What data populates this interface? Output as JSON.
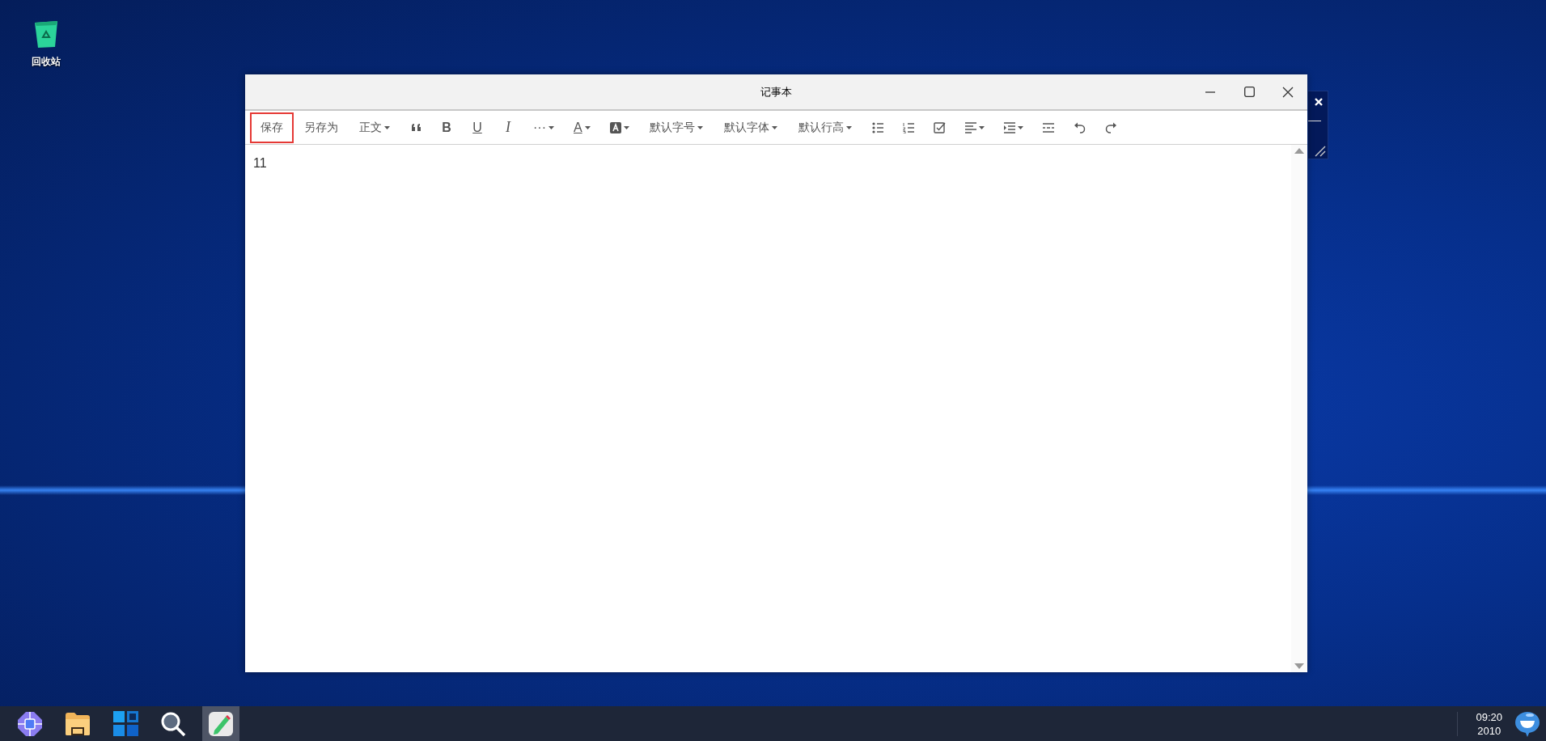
{
  "desktop": {
    "icons": [
      {
        "label": "回收站",
        "selected": false
      }
    ]
  },
  "window": {
    "title": "记事本"
  },
  "toolbar": {
    "items": [
      {
        "kind": "text",
        "label": "保存",
        "caret": false,
        "selected": true
      },
      {
        "kind": "text",
        "label": "另存为",
        "caret": false,
        "selected": false
      },
      {
        "kind": "text",
        "label": "正文",
        "caret": true,
        "selected": false
      },
      {
        "kind": "quote",
        "caret": false,
        "selected": false
      },
      {
        "kind": "bold",
        "label": "B",
        "caret": false,
        "selected": false
      },
      {
        "kind": "underline",
        "label": "U",
        "caret": false,
        "selected": false
      },
      {
        "kind": "italic",
        "label": "I",
        "caret": false,
        "selected": false
      },
      {
        "kind": "plain",
        "label": "···",
        "caret": true,
        "selected": false
      },
      {
        "kind": "underline",
        "label": "A",
        "caret": true,
        "selected": false
      },
      {
        "kind": "highlight",
        "caret": true,
        "selected": false
      },
      {
        "kind": "text",
        "label": "默认字号",
        "caret": true,
        "selected": false
      },
      {
        "kind": "text",
        "label": "默认字体",
        "caret": true,
        "selected": false
      },
      {
        "kind": "text",
        "label": "默认行高",
        "caret": true,
        "selected": false
      },
      {
        "kind": "bullets",
        "caret": false,
        "selected": false
      },
      {
        "kind": "numbers",
        "caret": false,
        "selected": false
      },
      {
        "kind": "tasks",
        "caret": false,
        "selected": false
      },
      {
        "kind": "align",
        "caret": true,
        "selected": false
      },
      {
        "kind": "indent",
        "caret": true,
        "selected": false
      },
      {
        "kind": "rule",
        "caret": false,
        "selected": false
      },
      {
        "kind": "undo",
        "caret": false,
        "selected": false
      },
      {
        "kind": "redo",
        "caret": false,
        "selected": false
      }
    ]
  },
  "editor": {
    "value": "11"
  },
  "taskbar": {
    "apps": [
      {
        "selected": false
      },
      {
        "selected": false
      },
      {
        "selected": false
      },
      {
        "selected": false
      },
      {
        "selected": true
      }
    ],
    "clock": {
      "time": "09:20",
      "year": "2010"
    }
  }
}
